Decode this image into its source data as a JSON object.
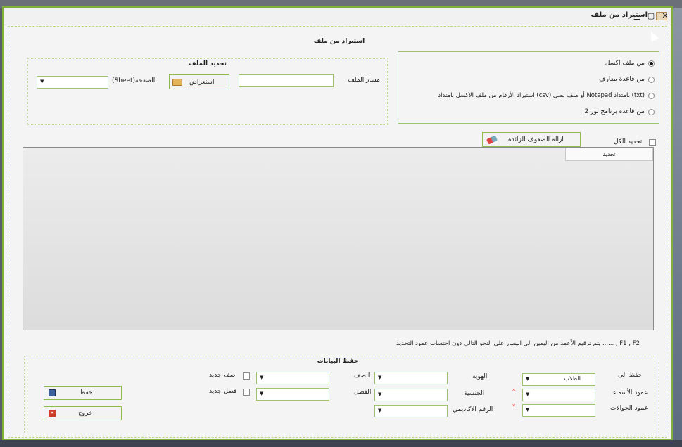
{
  "window": {
    "title": "استيراد من ملف",
    "min": "▁",
    "max": "▢",
    "close": "✕"
  },
  "main_title": "استيراد من ملف",
  "source": {
    "options": [
      {
        "label": "من ملف اكسل",
        "selected": true
      },
      {
        "label": "من قاعدة معارف",
        "selected": false
      },
      {
        "label": "(txt) بامتداد Notepad أو ملف نصي  (csv) استيراد الأرقام من ملف  الاكسل بامتداد",
        "selected": false
      },
      {
        "label": "من قاعدة برنامج نور 2",
        "selected": false
      }
    ]
  },
  "file_select": {
    "title": "تحديد الملف",
    "path_label": "مسار الملف",
    "browse_label": "استعراض",
    "sheet_label": "الصفحة(Sheet)",
    "path_value": ""
  },
  "select_all_label": "تحديد الكل",
  "remove_rows_label": "ازالة الصفوف الزائدة",
  "grid": {
    "columns": [
      "تحديد"
    ]
  },
  "note": "F1 , F2 , ...... يتم ترقيم الأعمد من اليمين الى اليسار علي النحو التالي  دون احتساب عمود التحديد",
  "save_section": {
    "title": "حفظ البيانات",
    "save_to_label": "حفظ الى",
    "save_to_value": "الطلاب",
    "names_col_label": "عمود الأسماء",
    "mobile_col_label": "عمود الجوالات",
    "id_label": "الهوية",
    "nationality_label": "الجنسية",
    "academic_no_label": "الرقم الاكاديمي",
    "grade_label": "الصف",
    "class_label": "الفصل",
    "new_grade_label": "صف جديد",
    "new_class_label": "فصل جديد",
    "required_mark": "*",
    "save_button": "حفظ",
    "exit_button": "خروج"
  },
  "colors": {
    "accent": "#7fb13a",
    "field_border": "#9cc470",
    "window_bg": "#f4f4f4"
  }
}
